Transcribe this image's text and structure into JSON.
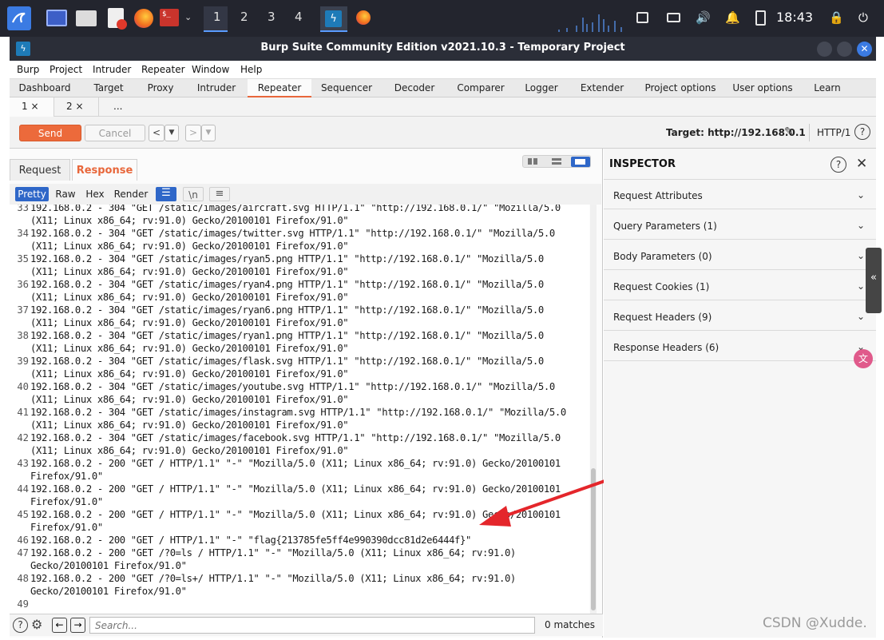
{
  "taskbar": {
    "workspaces": [
      "1",
      "2",
      "3",
      "4"
    ],
    "clock": "18:43"
  },
  "window": {
    "title": "Burp Suite Community Edition v2021.10.3 - Temporary Project"
  },
  "menu": [
    "Burp",
    "Project",
    "Intruder",
    "Repeater",
    "Window",
    "Help"
  ],
  "main_tabs": [
    "Dashboard",
    "Target",
    "Proxy",
    "Intruder",
    "Repeater",
    "Sequencer",
    "Decoder",
    "Comparer",
    "Logger",
    "Extender",
    "Project options",
    "User options",
    "Learn"
  ],
  "active_main_tab": "Repeater",
  "sub_tabs": [
    "1 ×",
    "2 ×",
    "..."
  ],
  "toolbar": {
    "send": "Send",
    "cancel": "Cancel",
    "target": "Target: http://192.168.0.1",
    "http_version": "HTTP/1"
  },
  "editor_tabs": {
    "request": "Request",
    "response": "Response"
  },
  "view_modes": [
    "Pretty",
    "Raw",
    "Hex",
    "Render",
    "\\n"
  ],
  "response_lines": [
    {
      "n": "33",
      "text": "192.168.0.2 - 304 \"GET /static/images/aircraft.svg HTTP/1.1\" \"http://192.168.0.1/\" \"Mozilla/5.0"
    },
    {
      "n": "",
      "text": "(X11; Linux x86_64; rv:91.0) Gecko/20100101 Firefox/91.0\""
    },
    {
      "n": "34",
      "text": "192.168.0.2 - 304 \"GET /static/images/twitter.svg HTTP/1.1\" \"http://192.168.0.1/\" \"Mozilla/5.0"
    },
    {
      "n": "",
      "text": "(X11; Linux x86_64; rv:91.0) Gecko/20100101 Firefox/91.0\""
    },
    {
      "n": "35",
      "text": "192.168.0.2 - 304 \"GET /static/images/ryan5.png HTTP/1.1\" \"http://192.168.0.1/\" \"Mozilla/5.0"
    },
    {
      "n": "",
      "text": "(X11; Linux x86_64; rv:91.0) Gecko/20100101 Firefox/91.0\""
    },
    {
      "n": "36",
      "text": "192.168.0.2 - 304 \"GET /static/images/ryan4.png HTTP/1.1\" \"http://192.168.0.1/\" \"Mozilla/5.0"
    },
    {
      "n": "",
      "text": "(X11; Linux x86_64; rv:91.0) Gecko/20100101 Firefox/91.0\""
    },
    {
      "n": "37",
      "text": "192.168.0.2 - 304 \"GET /static/images/ryan6.png HTTP/1.1\" \"http://192.168.0.1/\" \"Mozilla/5.0"
    },
    {
      "n": "",
      "text": "(X11; Linux x86_64; rv:91.0) Gecko/20100101 Firefox/91.0\""
    },
    {
      "n": "38",
      "text": "192.168.0.2 - 304 \"GET /static/images/ryan1.png HTTP/1.1\" \"http://192.168.0.1/\" \"Mozilla/5.0"
    },
    {
      "n": "",
      "text": "(X11; Linux x86_64; rv:91.0) Gecko/20100101 Firefox/91.0\""
    },
    {
      "n": "39",
      "text": "192.168.0.2 - 304 \"GET /static/images/flask.svg HTTP/1.1\" \"http://192.168.0.1/\" \"Mozilla/5.0"
    },
    {
      "n": "",
      "text": "(X11; Linux x86_64; rv:91.0) Gecko/20100101 Firefox/91.0\""
    },
    {
      "n": "40",
      "text": "192.168.0.2 - 304 \"GET /static/images/youtube.svg HTTP/1.1\" \"http://192.168.0.1/\" \"Mozilla/5.0"
    },
    {
      "n": "",
      "text": "(X11; Linux x86_64; rv:91.0) Gecko/20100101 Firefox/91.0\""
    },
    {
      "n": "41",
      "text": "192.168.0.2 - 304 \"GET /static/images/instagram.svg HTTP/1.1\" \"http://192.168.0.1/\" \"Mozilla/5.0"
    },
    {
      "n": "",
      "text": "(X11; Linux x86_64; rv:91.0) Gecko/20100101 Firefox/91.0\""
    },
    {
      "n": "42",
      "text": "192.168.0.2 - 304 \"GET /static/images/facebook.svg HTTP/1.1\" \"http://192.168.0.1/\" \"Mozilla/5.0"
    },
    {
      "n": "",
      "text": "(X11; Linux x86_64; rv:91.0) Gecko/20100101 Firefox/91.0\""
    },
    {
      "n": "43",
      "text": "192.168.0.2 - 200 \"GET / HTTP/1.1\" \"-\" \"Mozilla/5.0 (X11; Linux x86_64; rv:91.0) Gecko/20100101"
    },
    {
      "n": "",
      "text": "Firefox/91.0\""
    },
    {
      "n": "44",
      "text": "192.168.0.2 - 200 \"GET / HTTP/1.1\" \"-\" \"Mozilla/5.0 (X11; Linux x86_64; rv:91.0) Gecko/20100101"
    },
    {
      "n": "",
      "text": "Firefox/91.0\""
    },
    {
      "n": "45",
      "text": "192.168.0.2 - 200 \"GET / HTTP/1.1\" \"-\" \"Mozilla/5.0 (X11; Linux x86_64; rv:91.0) Gecko/20100101"
    },
    {
      "n": "",
      "text": "Firefox/91.0\""
    },
    {
      "n": "46",
      "text": "192.168.0.2 - 200 \"GET / HTTP/1.1\" \"-\" \"flag{213785fe5ff4e990390dcc81d2e6444f}\""
    },
    {
      "n": "47",
      "text": "192.168.0.2 - 200 \"GET /?0=ls / HTTP/1.1\" \"-\" \"Mozilla/5.0 (X11; Linux x86_64; rv:91.0)"
    },
    {
      "n": "",
      "text": "Gecko/20100101 Firefox/91.0\""
    },
    {
      "n": "48",
      "text": "192.168.0.2 - 200 \"GET /?0=ls+/ HTTP/1.1\" \"-\" \"Mozilla/5.0 (X11; Linux x86_64; rv:91.0)"
    },
    {
      "n": "",
      "text": "Gecko/20100101 Firefox/91.0\""
    },
    {
      "n": "49",
      "text": ""
    }
  ],
  "search": {
    "placeholder": "Search...",
    "matches": "0 matches"
  },
  "inspector": {
    "title": "INSPECTOR",
    "sections": [
      "Request Attributes",
      "Query Parameters (1)",
      "Body Parameters (0)",
      "Request Cookies (1)",
      "Request Headers (9)",
      "Response Headers (6)"
    ]
  },
  "watermark": "CSDN @Xudde."
}
